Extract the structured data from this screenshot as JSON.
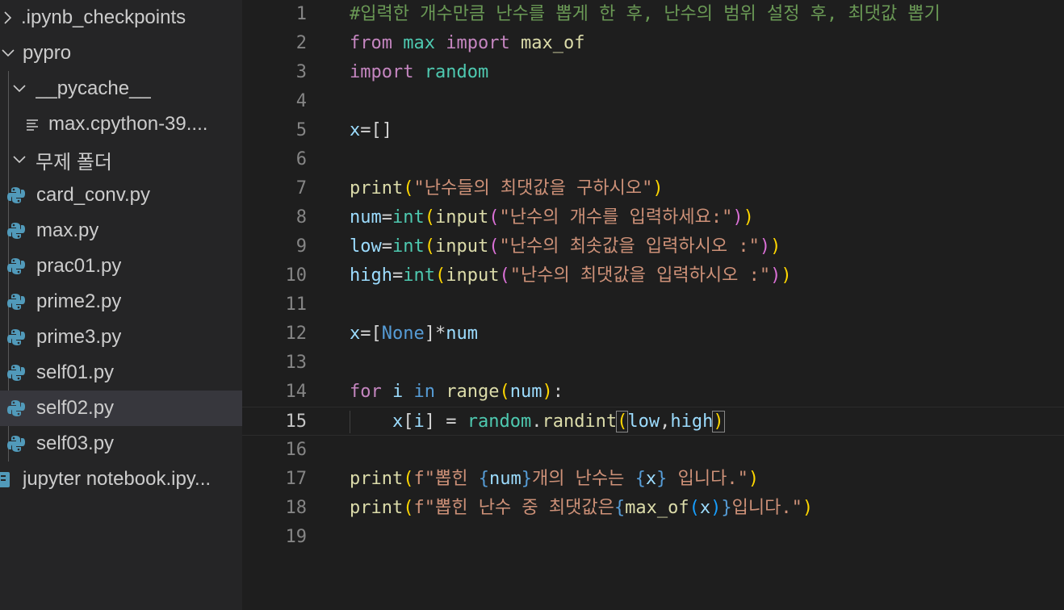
{
  "explorer": {
    "items": [
      {
        "label": ".ipynb_checkpoints",
        "kind": "folder-collapsed"
      },
      {
        "label": "pypro",
        "kind": "folder-expanded"
      },
      {
        "label": "__pycache__",
        "kind": "folder-expanded"
      },
      {
        "label": "max.cpython-39....",
        "kind": "file-generic"
      },
      {
        "label": "무제 폴더",
        "kind": "folder-expanded"
      },
      {
        "label": "card_conv.py",
        "kind": "file-python"
      },
      {
        "label": "max.py",
        "kind": "file-python"
      },
      {
        "label": "prac01.py",
        "kind": "file-python"
      },
      {
        "label": "prime2.py",
        "kind": "file-python"
      },
      {
        "label": "prime3.py",
        "kind": "file-python"
      },
      {
        "label": "self01.py",
        "kind": "file-python"
      },
      {
        "label": "self02.py",
        "kind": "file-python",
        "selected": true
      },
      {
        "label": "self03.py",
        "kind": "file-python"
      },
      {
        "label": "jupyter notebook.ipy...",
        "kind": "file-notebook"
      }
    ]
  },
  "editor": {
    "current_line": 15,
    "line_numbers": [
      "1",
      "2",
      "3",
      "4",
      "5",
      "6",
      "7",
      "8",
      "9",
      "10",
      "11",
      "12",
      "13",
      "14",
      "15",
      "16",
      "17",
      "18",
      "19"
    ],
    "lines": [
      [
        [
          "cm",
          "#입력한 개수만큼 난수를 뽑게 한 후, 난수의 범위 설정 후, 최댓값 뽑기"
        ]
      ],
      [
        [
          "kw",
          "from"
        ],
        [
          "pl",
          " "
        ],
        [
          "mod",
          "max"
        ],
        [
          "pl",
          " "
        ],
        [
          "kw",
          "import"
        ],
        [
          "pl",
          " "
        ],
        [
          "fn",
          "max_of"
        ]
      ],
      [
        [
          "kw",
          "import"
        ],
        [
          "pl",
          " "
        ],
        [
          "mod",
          "random"
        ]
      ],
      [],
      [
        [
          "var",
          "x"
        ],
        [
          "pl",
          "=[]"
        ]
      ],
      [],
      [
        [
          "fn",
          "print"
        ],
        [
          "br1",
          "("
        ],
        [
          "str",
          "\"난수들의 최댓값을 구하시오\""
        ],
        [
          "br1",
          ")"
        ]
      ],
      [
        [
          "var",
          "num"
        ],
        [
          "pl",
          "="
        ],
        [
          "mod",
          "int"
        ],
        [
          "br1",
          "("
        ],
        [
          "fn",
          "input"
        ],
        [
          "br2",
          "("
        ],
        [
          "str",
          "\"난수의 개수를 입력하세요:\""
        ],
        [
          "br2",
          ")"
        ],
        [
          "br1",
          ")"
        ]
      ],
      [
        [
          "var",
          "low"
        ],
        [
          "pl",
          "="
        ],
        [
          "mod",
          "int"
        ],
        [
          "br1",
          "("
        ],
        [
          "fn",
          "input"
        ],
        [
          "br2",
          "("
        ],
        [
          "str",
          "\"난수의 최솟값을 입력하시오 :\""
        ],
        [
          "br2",
          ")"
        ],
        [
          "br1",
          ")"
        ]
      ],
      [
        [
          "var",
          "high"
        ],
        [
          "pl",
          "="
        ],
        [
          "mod",
          "int"
        ],
        [
          "br1",
          "("
        ],
        [
          "fn",
          "input"
        ],
        [
          "br2",
          "("
        ],
        [
          "str",
          "\"난수의 최댓값을 입력하시오 :\""
        ],
        [
          "br2",
          ")"
        ],
        [
          "br1",
          ")"
        ]
      ],
      [],
      [
        [
          "var",
          "x"
        ],
        [
          "pl",
          "=["
        ],
        [
          "bl",
          "None"
        ],
        [
          "pl",
          "]*"
        ],
        [
          "var",
          "num"
        ]
      ],
      [],
      [
        [
          "kw",
          "for"
        ],
        [
          "pl",
          " "
        ],
        [
          "var",
          "i"
        ],
        [
          "pl",
          " "
        ],
        [
          "bl",
          "in"
        ],
        [
          "pl",
          " "
        ],
        [
          "fn",
          "range"
        ],
        [
          "br1",
          "("
        ],
        [
          "var",
          "num"
        ],
        [
          "br1",
          ")"
        ],
        [
          "pl",
          ":"
        ]
      ],
      [
        [
          "pl",
          "    "
        ],
        [
          "var",
          "x"
        ],
        [
          "pl",
          "["
        ],
        [
          "var",
          "i"
        ],
        [
          "pl",
          "] = "
        ],
        [
          "mod",
          "random"
        ],
        [
          "pl",
          "."
        ],
        [
          "fn",
          "randint"
        ],
        [
          "br1",
          "(",
          "match"
        ],
        [
          "var",
          "low"
        ],
        [
          "pl",
          ","
        ],
        [
          "var",
          "high"
        ],
        [
          "br1",
          ")",
          "match"
        ]
      ],
      [],
      [
        [
          "fn",
          "print"
        ],
        [
          "br1",
          "("
        ],
        [
          "str",
          "f\"뽑힌 "
        ],
        [
          "bl",
          "{"
        ],
        [
          "var",
          "num"
        ],
        [
          "bl",
          "}"
        ],
        [
          "str",
          "개의 난수는 "
        ],
        [
          "bl",
          "{"
        ],
        [
          "var",
          "x"
        ],
        [
          "bl",
          "}"
        ],
        [
          "str",
          " 입니다.\""
        ],
        [
          "br1",
          ")"
        ]
      ],
      [
        [
          "fn",
          "print"
        ],
        [
          "br1",
          "("
        ],
        [
          "str",
          "f\"뽑힌 난수 중 최댓값은"
        ],
        [
          "bl",
          "{"
        ],
        [
          "fn",
          "max_of"
        ],
        [
          "br3",
          "("
        ],
        [
          "var",
          "x"
        ],
        [
          "br3",
          ")"
        ],
        [
          "bl",
          "}"
        ],
        [
          "str",
          "입니다.\""
        ],
        [
          "br1",
          ")"
        ]
      ],
      []
    ]
  }
}
